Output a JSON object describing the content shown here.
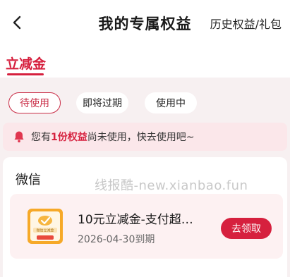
{
  "header": {
    "title": "我的专属权益",
    "history_link": "历史权益/礼包"
  },
  "tabs": {
    "active_label": "立减金"
  },
  "filters": [
    {
      "label": "待使用",
      "active": true
    },
    {
      "label": "即将过期",
      "active": false
    },
    {
      "label": "使用中",
      "active": false
    }
  ],
  "notice": {
    "prefix": "您有",
    "highlight": "1份权益",
    "suffix": "尚未使用，快去使用吧~"
  },
  "section": {
    "title": "微信",
    "watermark": "线报酷-new.xianbao.fun"
  },
  "coupon": {
    "icon_label": "微信立减金",
    "name": "10元立减金-支付超…",
    "expiry": "2026-04-30到期",
    "button_label": "去领取"
  },
  "colors": {
    "accent": "#d6203e",
    "page_bg": "#f7f0f1",
    "notice_bg": "#fbe7ea",
    "coupon_bg": "#fdf1f2"
  }
}
